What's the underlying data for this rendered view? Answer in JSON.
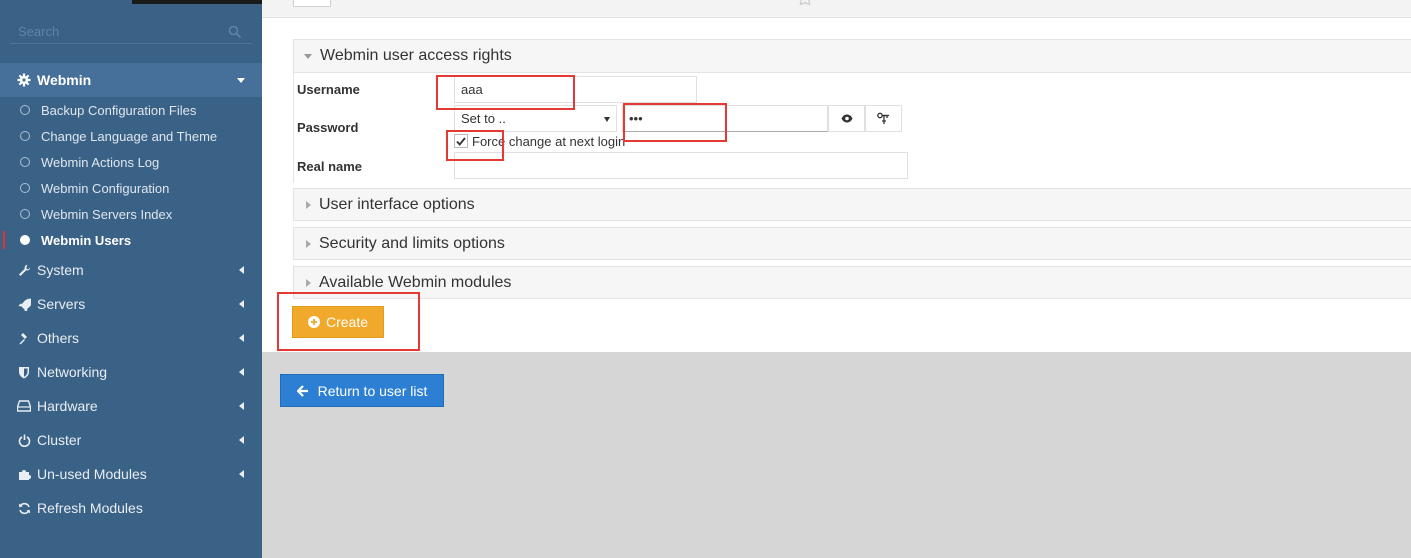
{
  "sidebar": {
    "search_placeholder": "Search",
    "active_module": {
      "label": "Webmin",
      "icon": "gear-icon"
    },
    "subitems": [
      {
        "label": "Backup Configuration Files",
        "active": false
      },
      {
        "label": "Change Language and Theme",
        "active": false
      },
      {
        "label": "Webmin Actions Log",
        "active": false
      },
      {
        "label": "Webmin Configuration",
        "active": false
      },
      {
        "label": "Webmin Servers Index",
        "active": false
      },
      {
        "label": "Webmin Users",
        "active": true
      }
    ],
    "menu": [
      {
        "label": "System",
        "icon": "wrench-icon"
      },
      {
        "label": "Servers",
        "icon": "rocket-icon"
      },
      {
        "label": "Others",
        "icon": "tools-icon"
      },
      {
        "label": "Networking",
        "icon": "shield-icon"
      },
      {
        "label": "Hardware",
        "icon": "hdd-icon"
      },
      {
        "label": "Cluster",
        "icon": "power-icon"
      },
      {
        "label": "Un-used Modules",
        "icon": "puzzle-icon"
      },
      {
        "label": "Refresh Modules",
        "icon": "refresh-icon"
      }
    ]
  },
  "form": {
    "section_access": "Webmin user access rights",
    "username_label": "Username",
    "username_value": "aaa",
    "password_label": "Password",
    "password_mode": "Set to ..",
    "password_value": "•••",
    "force_change_label": "Force change at next login",
    "force_change_checked": true,
    "realname_label": "Real name",
    "realname_value": "",
    "section_ui": "User interface options",
    "section_security": "Security and limits options",
    "section_modules": "Available Webmin modules"
  },
  "actions": {
    "create_label": "Create",
    "return_label": "Return to user list"
  },
  "colors": {
    "sidebar_bg": "#3a6186",
    "create_button": "#f0a92a",
    "return_button": "#2d7fd3",
    "annotation": "#e53935"
  }
}
